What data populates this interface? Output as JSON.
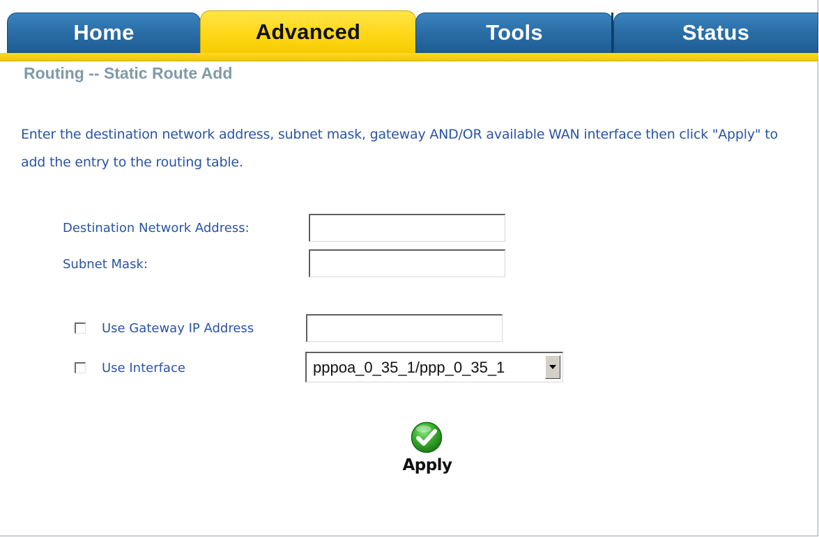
{
  "nav": {
    "tabs": [
      {
        "label": "Home",
        "active": false
      },
      {
        "label": "Advanced",
        "active": true
      },
      {
        "label": "Tools",
        "active": false
      },
      {
        "label": "Status",
        "active": false
      }
    ]
  },
  "page": {
    "title": "Routing -- Static Route Add",
    "instructions": "Enter the destination network address, subnet mask, gateway AND/OR available WAN interface then click \"Apply\" to add the entry to the routing table."
  },
  "form": {
    "destination": {
      "label": "Destination Network Address:",
      "value": ""
    },
    "subnet_mask": {
      "label": "Subnet Mask:",
      "value": ""
    },
    "use_gateway": {
      "label": "Use Gateway IP Address",
      "checked": false,
      "value": ""
    },
    "use_interface": {
      "label": "Use Interface",
      "checked": false,
      "selected": "pppoa_0_35_1/ppp_0_35_1"
    }
  },
  "actions": {
    "apply_label": "Apply"
  },
  "colors": {
    "tab_blue": "#2b6fa8",
    "tab_active_yellow": "#ffd81a",
    "title_gray": "#7f9aa8",
    "label_blue": "#2a53a5",
    "apply_green": "#2ea82a"
  },
  "icons": {
    "apply": "green-checkmark-icon"
  }
}
